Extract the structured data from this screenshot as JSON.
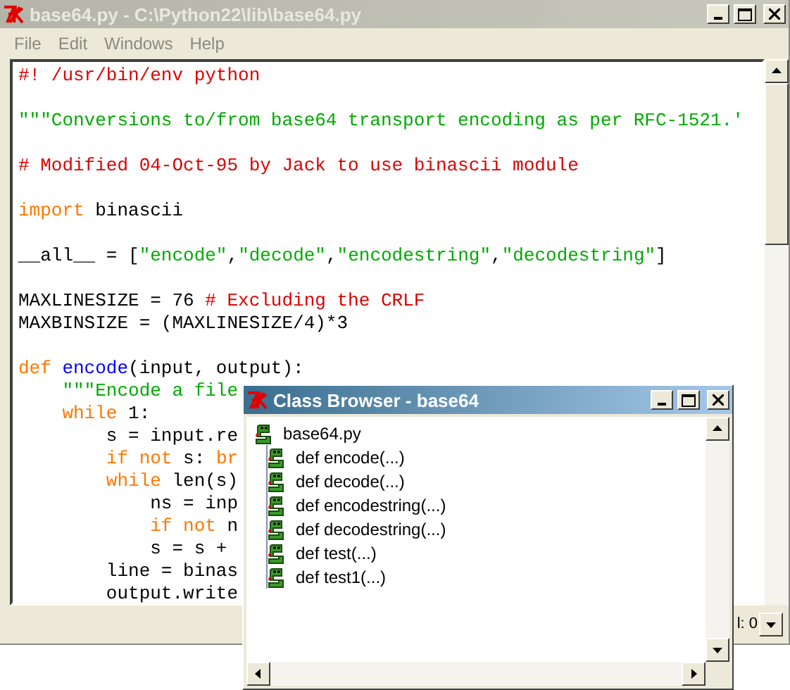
{
  "window": {
    "title": "base64.py - C:\\Python22\\lib\\base64.py",
    "active": false
  },
  "menu": [
    "File",
    "Edit",
    "Windows",
    "Help"
  ],
  "editor": {
    "lines": [
      {
        "kind": "code",
        "tokens": [
          {
            "text": "#! /usr/bin/env python",
            "kind": "comment"
          }
        ]
      },
      {
        "kind": "blank"
      },
      {
        "kind": "code",
        "tokens": [
          {
            "text": "\"\"\"Conversions to/from base64 transport encoding as per RFC-1521.'",
            "kind": "string"
          }
        ]
      },
      {
        "kind": "blank"
      },
      {
        "kind": "code",
        "tokens": [
          {
            "text": "# Modified 04-Oct-95 by Jack to use binascii module",
            "kind": "comment"
          }
        ]
      },
      {
        "kind": "blank"
      },
      {
        "kind": "code",
        "tokens": [
          {
            "text": "import",
            "kind": "keyword"
          },
          {
            "text": " binascii",
            "kind": "plain"
          }
        ]
      },
      {
        "kind": "blank"
      },
      {
        "kind": "code",
        "tokens": [
          {
            "text": "__all__ = [",
            "kind": "plain"
          },
          {
            "text": "\"encode\"",
            "kind": "string"
          },
          {
            "text": ",",
            "kind": "plain"
          },
          {
            "text": "\"decode\"",
            "kind": "string"
          },
          {
            "text": ",",
            "kind": "plain"
          },
          {
            "text": "\"encodestring\"",
            "kind": "string"
          },
          {
            "text": ",",
            "kind": "plain"
          },
          {
            "text": "\"decodestring\"",
            "kind": "string"
          },
          {
            "text": "]",
            "kind": "plain"
          }
        ]
      },
      {
        "kind": "blank"
      },
      {
        "kind": "code",
        "tokens": [
          {
            "text": "MAXLINESIZE = 76 ",
            "kind": "plain"
          },
          {
            "text": "# Excluding the CRLF",
            "kind": "comment"
          }
        ]
      },
      {
        "kind": "code",
        "tokens": [
          {
            "text": "MAXBINSIZE = (MAXLINESIZE/4)*3",
            "kind": "plain"
          }
        ]
      },
      {
        "kind": "blank"
      },
      {
        "kind": "code",
        "tokens": [
          {
            "text": "def",
            "kind": "keyword"
          },
          {
            "text": " encode",
            "kind": "definition"
          },
          {
            "text": "(input, output):",
            "kind": "plain"
          }
        ]
      },
      {
        "kind": "code",
        "tokens": [
          {
            "text": "    \"\"\"Encode a file",
            "kind": "string"
          }
        ]
      },
      {
        "kind": "code",
        "tokens": [
          {
            "text": "    while",
            "kind": "keyword"
          },
          {
            "text": " 1:",
            "kind": "plain"
          }
        ]
      },
      {
        "kind": "code",
        "tokens": [
          {
            "text": "        s = input.re",
            "kind": "plain"
          }
        ]
      },
      {
        "kind": "code",
        "tokens": [
          {
            "text": "        if not",
            "kind": "keyword"
          },
          {
            "text": " s: ",
            "kind": "plain"
          },
          {
            "text": "br",
            "kind": "keyword"
          }
        ]
      },
      {
        "kind": "code",
        "tokens": [
          {
            "text": "        while",
            "kind": "keyword"
          },
          {
            "text": " len(s)",
            "kind": "plain"
          }
        ]
      },
      {
        "kind": "code",
        "tokens": [
          {
            "text": "            ns = inp",
            "kind": "plain"
          }
        ]
      },
      {
        "kind": "code",
        "tokens": [
          {
            "text": "            if not",
            "kind": "keyword"
          },
          {
            "text": " n",
            "kind": "plain"
          }
        ]
      },
      {
        "kind": "code",
        "tokens": [
          {
            "text": "            s = s +",
            "kind": "plain"
          }
        ]
      },
      {
        "kind": "code",
        "tokens": [
          {
            "text": "        line = binas",
            "kind": "plain"
          }
        ]
      },
      {
        "kind": "code",
        "tokens": [
          {
            "text": "        output.write",
            "kind": "plain"
          }
        ]
      }
    ]
  },
  "status_bar": {
    "column": "l: 0"
  },
  "class_browser": {
    "title": "Class Browser - base64",
    "active": true,
    "tree": {
      "label": "base64.py",
      "children": [
        {
          "label": "def encode(...)"
        },
        {
          "label": "def decode(...)"
        },
        {
          "label": "def encodestring(...)"
        },
        {
          "label": "def decodestring(...)"
        },
        {
          "label": "def test(...)"
        },
        {
          "label": "def test1(...)"
        }
      ]
    }
  }
}
